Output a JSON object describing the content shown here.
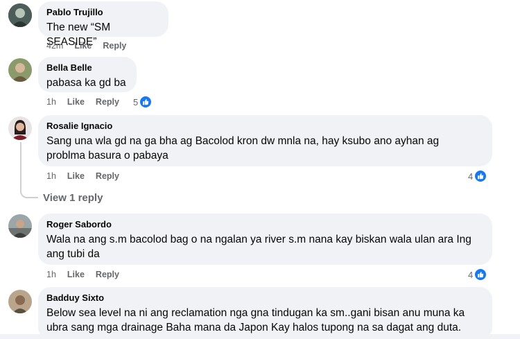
{
  "comments": [
    {
      "author": "Pablo Trujillo",
      "text": "The new “SM SEASIDE”",
      "time": "42m",
      "like_label": "Like",
      "reply_label": "Reply"
    },
    {
      "author": "Bella Belle",
      "text": "pabasa ka gd ba",
      "time": "1h",
      "like_label": "Like",
      "reply_label": "Reply",
      "reactions": "5"
    },
    {
      "author": "Rosalie Ignacio",
      "text_line1": "Sang una wla gd na ga bha ag Bacolod kron dw mnla na, hay ksubo ano ayhan ag",
      "text_line2": "problma basura o pabaya",
      "time": "1h",
      "like_label": "Like",
      "reply_label": "Reply",
      "reactions": "4",
      "view_replies": "View 1 reply"
    },
    {
      "author": "Roger Sabordo",
      "text_line1": "Wala na ang s.m bacolod bag o na ngalan ya river s.m nana kay biskan wala ulan ara Ing",
      "text_line2": "ang tubi da",
      "time": "1h",
      "like_label": "Like",
      "reply_label": "Reply",
      "reactions": "4"
    },
    {
      "author": "Badduy Sixto",
      "text_line1": "Below sea level na ni ang reclamation nga gna tindugan ka sm..gani bisan anu muna ka",
      "text_line2": "ubra sang mga drainage Baha mana da Japon Kay halos tupong na sa dagat ang duta."
    }
  ],
  "colors": {
    "bubble": "#f0f2f5",
    "meta_text": "#65676b",
    "like_blue": "#1877f2"
  },
  "icons": {
    "reaction": "like-thumb-icon"
  }
}
